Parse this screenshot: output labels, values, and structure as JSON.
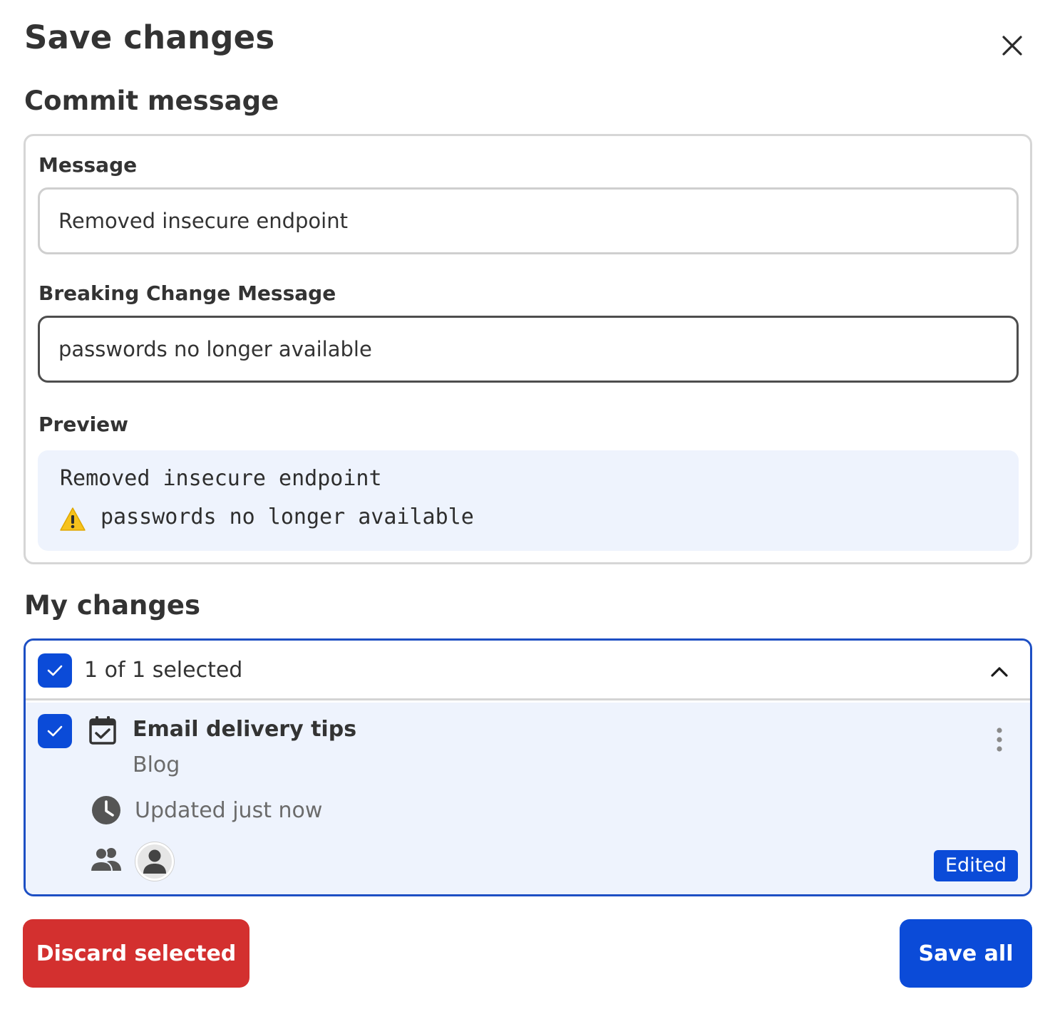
{
  "dialog": {
    "title": "Save changes",
    "close_icon": "close-icon"
  },
  "commit": {
    "heading": "Commit message",
    "message_label": "Message",
    "message_value": "Removed insecure endpoint",
    "breaking_label": "Breaking Change Message",
    "breaking_value": "passwords no longer available",
    "preview_label": "Preview",
    "preview_line1": "Removed insecure endpoint",
    "preview_line2": "passwords no longer available",
    "preview_warn_icon": "warning-icon"
  },
  "changes": {
    "heading": "My changes",
    "selected_text": "1 of 1 selected",
    "items": [
      {
        "title": "Email delivery tips",
        "subtitle": "Blog",
        "updated": "Updated just now",
        "badge": "Edited",
        "type_icon": "calendar-check-icon"
      }
    ]
  },
  "actions": {
    "discard_label": "Discard selected",
    "save_label": "Save all"
  },
  "colors": {
    "primary": "#0b4bd8",
    "danger": "#d3302f",
    "preview_bg": "#eef3fd"
  }
}
